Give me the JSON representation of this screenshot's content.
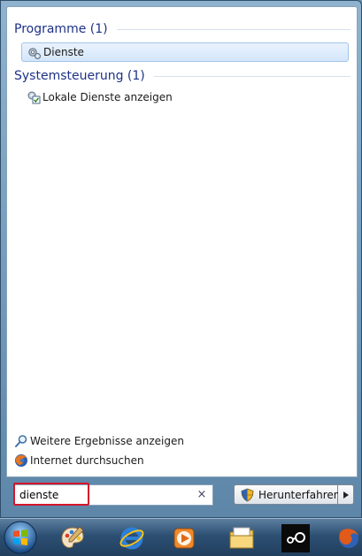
{
  "sections": [
    {
      "title": "Programme (1)"
    },
    {
      "title": "Systemsteuerung (1)"
    }
  ],
  "results": {
    "programs": [
      {
        "label": "Dienste",
        "icon": "services-gear-icon",
        "selected": true
      }
    ],
    "control_panel": [
      {
        "label": "Lokale Dienste anzeigen",
        "icon": "services-checklist-icon",
        "selected": false
      }
    ]
  },
  "bottom_links": [
    {
      "label": "Weitere Ergebnisse anzeigen",
      "icon": "magnifier-icon"
    },
    {
      "label": "Internet durchsuchen",
      "icon": "firefox-icon"
    }
  ],
  "search": {
    "value": "dienste",
    "clear_symbol": "×"
  },
  "shutdown": {
    "label": "Herunterfahren",
    "icon": "uac-shield-icon"
  },
  "taskbar": {
    "items": [
      {
        "icon": "windows-start-orb-icon"
      },
      {
        "icon": "paint-palette-icon"
      },
      {
        "icon": "internet-explorer-icon"
      },
      {
        "icon": "media-player-icon"
      },
      {
        "icon": "file-explorer-icon"
      },
      {
        "icon": "steam-icon"
      },
      {
        "icon": "browser-icon"
      }
    ]
  },
  "colors": {
    "section_title": "#1e3287",
    "search_highlight": "#d4162b",
    "selected_bg": "#d4e6fb"
  }
}
